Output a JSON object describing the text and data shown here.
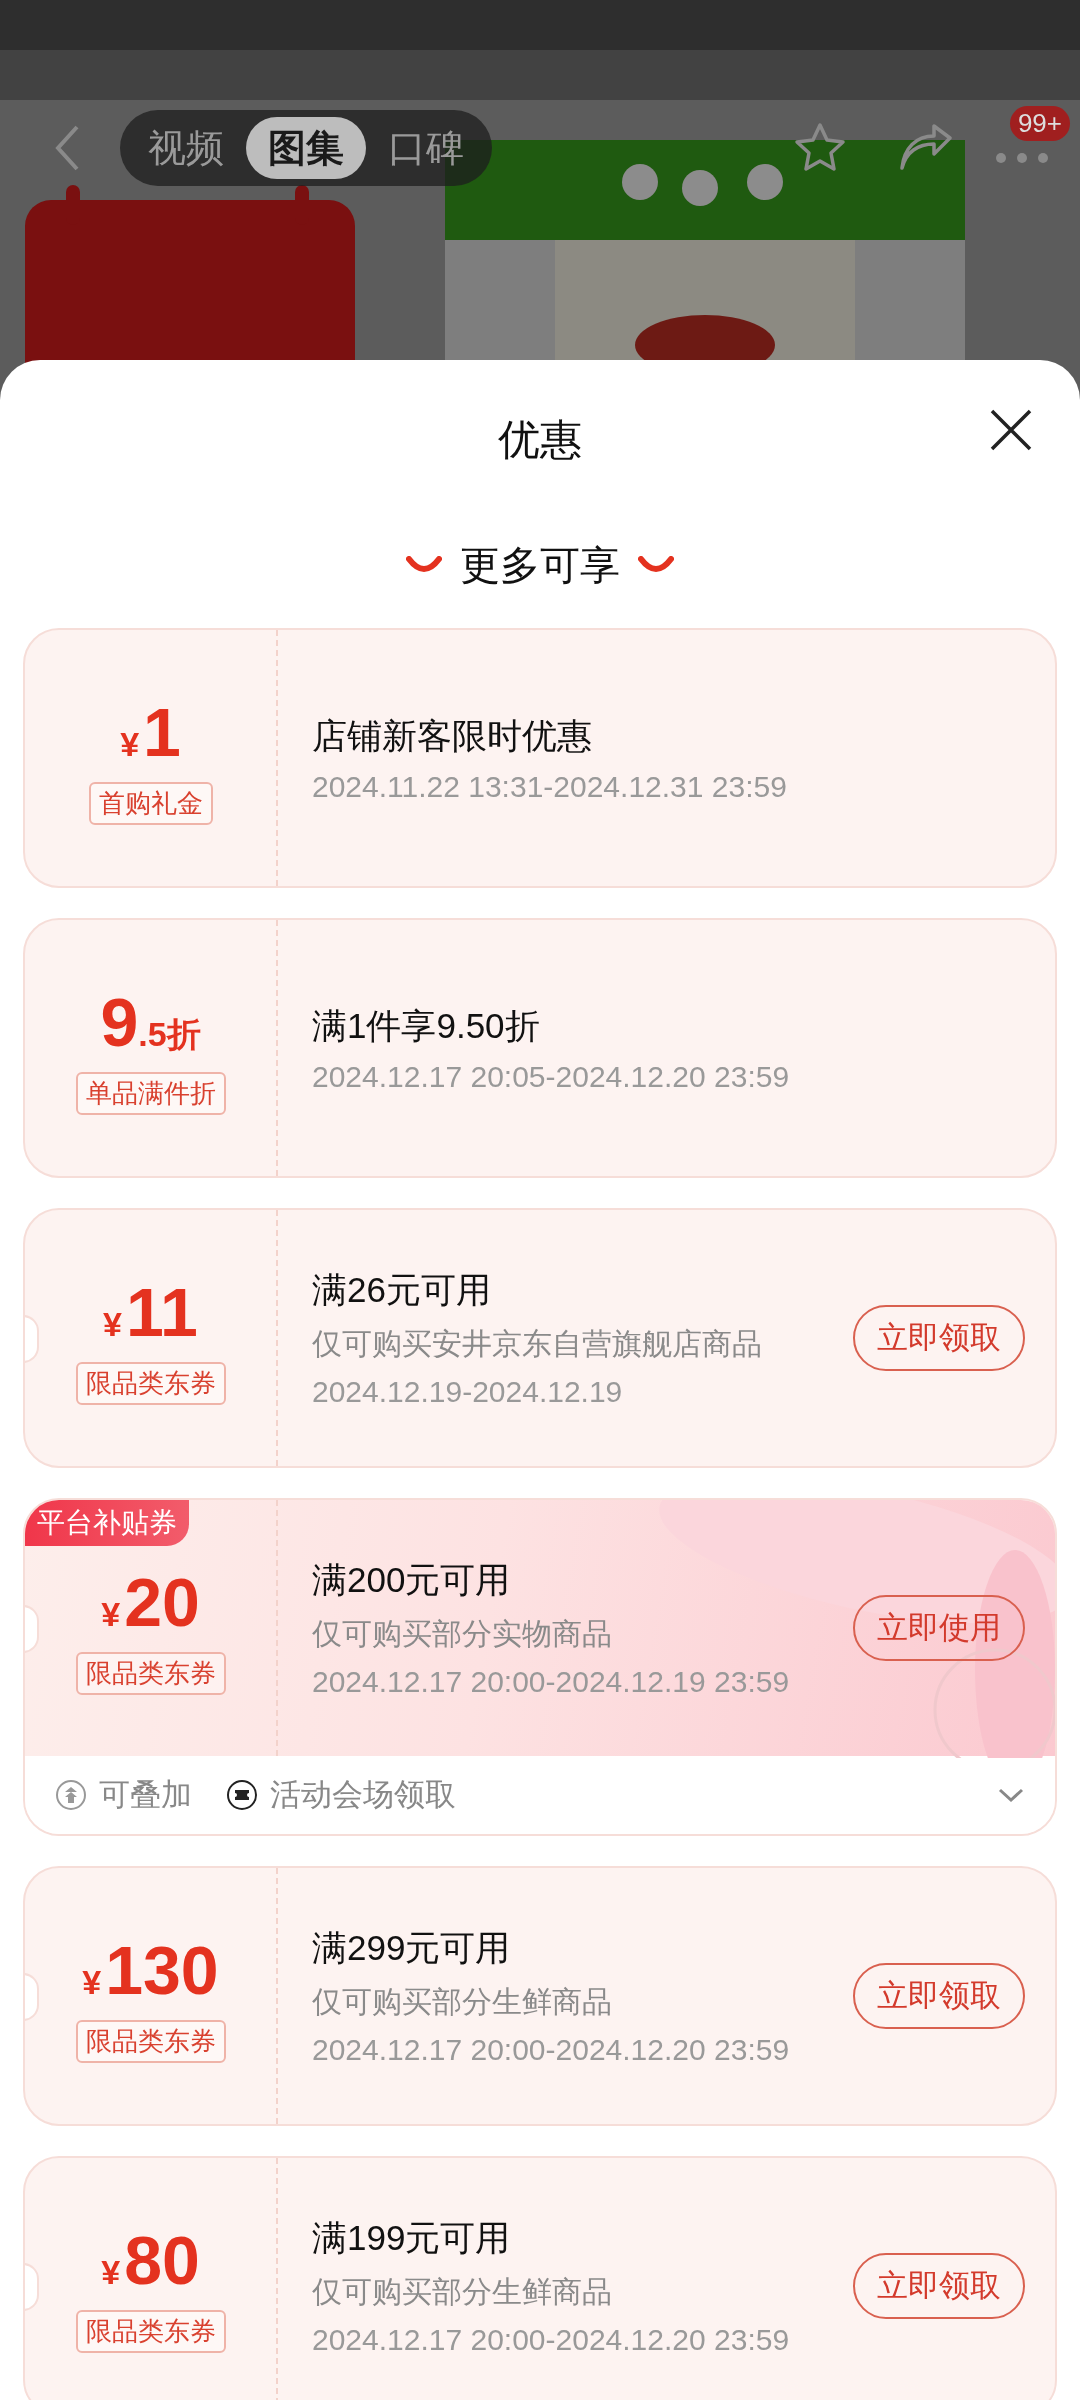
{
  "nav": {
    "tabs": [
      {
        "label": "视频",
        "selected": false
      },
      {
        "label": "图集",
        "selected": true
      },
      {
        "label": "口碑",
        "selected": false
      }
    ],
    "badge": "99+"
  },
  "sheet": {
    "title": "优惠",
    "section_title": "更多可享"
  },
  "coupons": [
    {
      "kind": "amount",
      "currency": "¥",
      "amount": "1",
      "tag": "首购礼金",
      "title": "店铺新客限时优惠",
      "validity": "2024.11.22 13:31-2024.12.31 23:59",
      "notched": false,
      "highlighted": false
    },
    {
      "kind": "discount",
      "amount": "9",
      "unit": ".5折",
      "tag": "单品满件折",
      "title": "满1件享9.50折",
      "validity": "2024.12.17 20:05-2024.12.20 23:59",
      "notched": false,
      "highlighted": false
    },
    {
      "kind": "amount",
      "currency": "¥",
      "amount": "11",
      "tag": "限品类东券",
      "title": "满26元可用",
      "scope": "仅可购买安井京东自营旗舰店商品",
      "validity": "2024.12.19-2024.12.19",
      "button": "立即领取",
      "notched": true,
      "highlighted": false
    },
    {
      "kind": "amount",
      "currency": "¥",
      "amount": "20",
      "tag": "限品类东券",
      "platform_tag": "平台补贴券",
      "title": "满200元可用",
      "scope": "仅可购买部分实物商品",
      "validity": "2024.12.17 20:00-2024.12.19 23:59",
      "button": "立即使用",
      "notched": true,
      "highlighted": true,
      "footer": {
        "expanded": false,
        "items": [
          {
            "kind": "stack",
            "label": "可叠加"
          },
          {
            "kind": "ticket",
            "label": "活动会场领取"
          }
        ]
      }
    },
    {
      "kind": "amount",
      "currency": "¥",
      "amount": "130",
      "tag": "限品类东券",
      "title": "满299元可用",
      "scope": "仅可购买部分生鲜商品",
      "validity": "2024.12.17 20:00-2024.12.20 23:59",
      "button": "立即领取",
      "notched": true,
      "highlighted": false
    },
    {
      "kind": "amount",
      "currency": "¥",
      "amount": "80",
      "tag": "限品类东券",
      "title": "满199元可用",
      "scope": "仅可购买部分生鲜商品",
      "validity": "2024.12.17 20:00-2024.12.20 23:59",
      "button": "立即领取",
      "notched": true,
      "highlighted": false
    }
  ]
}
